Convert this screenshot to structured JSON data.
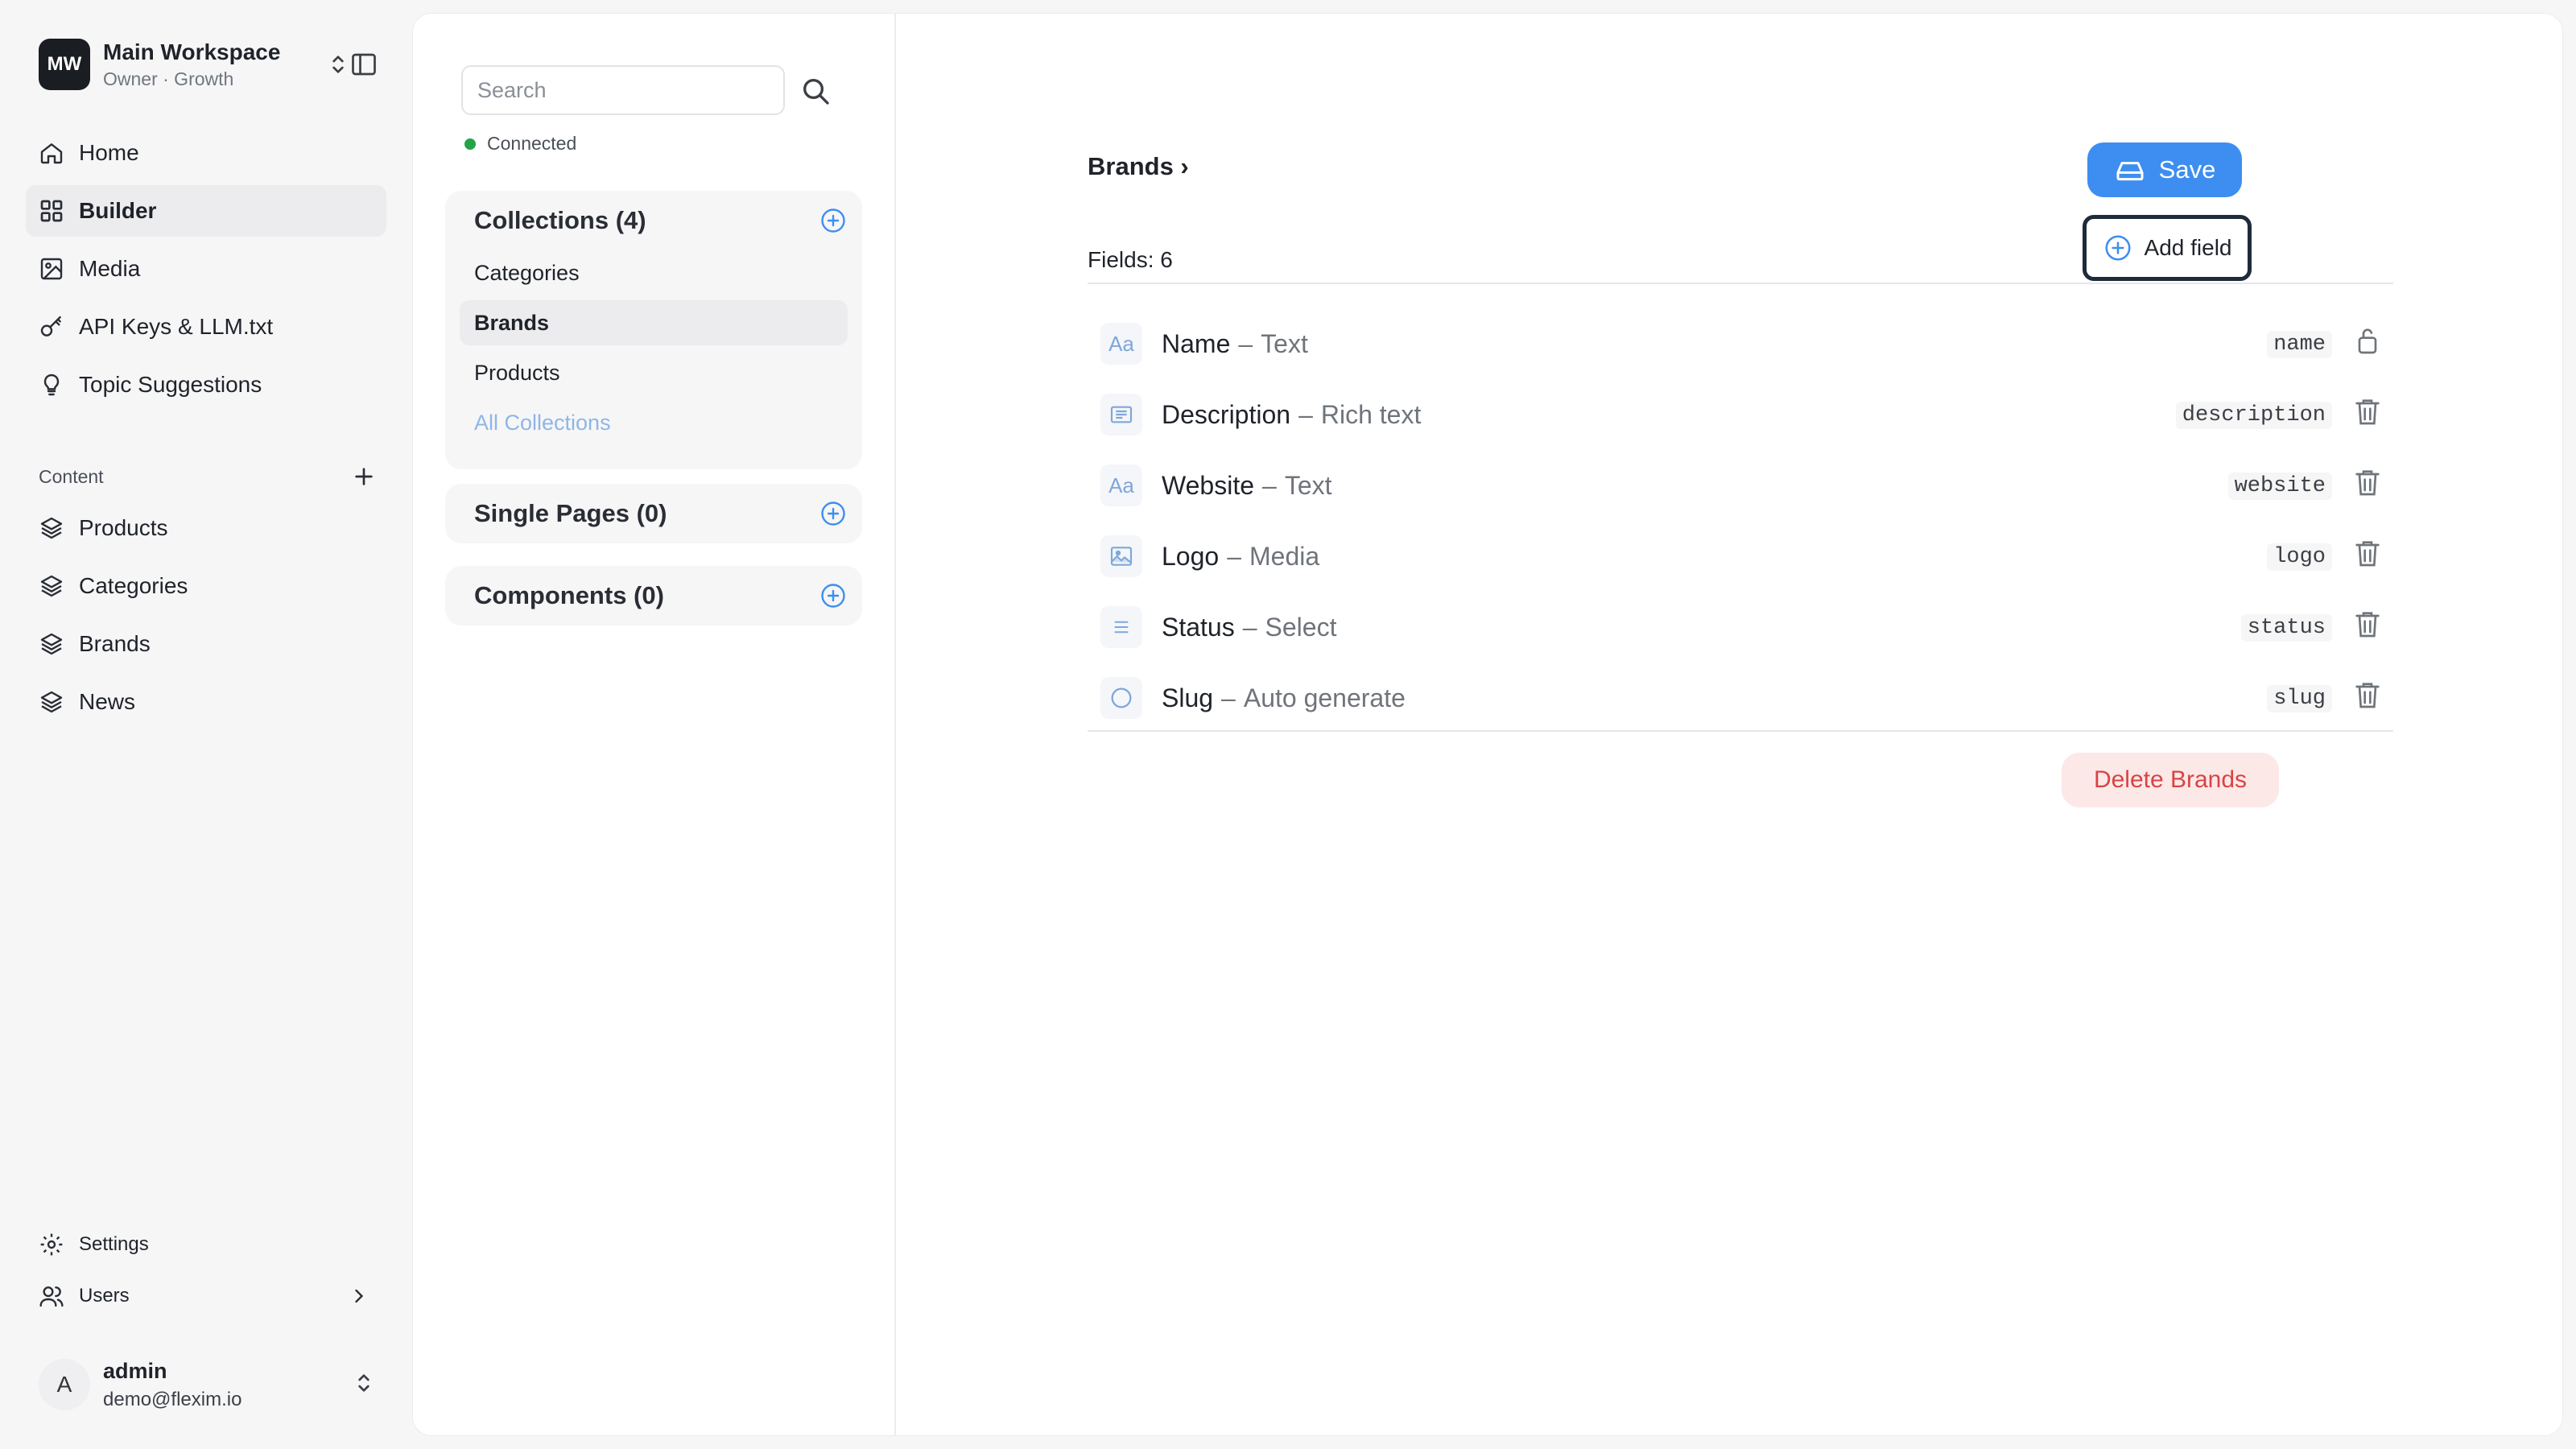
{
  "workspace": {
    "initials": "MW",
    "name": "Main Workspace",
    "subtitle": "Owner · Growth"
  },
  "nav": [
    {
      "label": "Home",
      "icon": "home-icon"
    },
    {
      "label": "Builder",
      "icon": "grid-icon",
      "active": true
    },
    {
      "label": "Media",
      "icon": "image-icon"
    },
    {
      "label": "API Keys & LLM.txt",
      "icon": "key-icon"
    },
    {
      "label": "Topic Suggestions",
      "icon": "lightbulb-icon"
    }
  ],
  "content_section": {
    "title": "Content",
    "items": [
      {
        "label": "Products",
        "icon": "layers-icon"
      },
      {
        "label": "Categories",
        "icon": "layers-icon"
      },
      {
        "label": "Brands",
        "icon": "layers-icon"
      },
      {
        "label": "News",
        "icon": "layers-icon"
      }
    ]
  },
  "bottom_nav": {
    "settings": "Settings",
    "users": "Users"
  },
  "user": {
    "initial": "A",
    "name": "admin",
    "email": "demo@flexim.io"
  },
  "search": {
    "placeholder": "Search",
    "status": "Connected",
    "status_color": "#22a447"
  },
  "collections": {
    "title": "Collections (4)",
    "items": [
      "Categories",
      "Brands",
      "Products"
    ],
    "active": "Brands",
    "all_link": "All Collections"
  },
  "single_pages": {
    "title": "Single Pages (0)"
  },
  "components": {
    "title": "Components (0)"
  },
  "editor": {
    "breadcrumb": "Brands ›",
    "save_label": "Save",
    "fields_count": "Fields: 6",
    "add_field_label": "Add field",
    "delete_label": "Delete Brands",
    "accent_color": "#3d8ef0",
    "fields": [
      {
        "name": "Name",
        "type": "Text",
        "key": "name",
        "icon": "text-aa-icon",
        "action": "lock-icon"
      },
      {
        "name": "Description",
        "type": "Rich text",
        "key": "description",
        "icon": "rich-text-icon",
        "action": "trash-icon"
      },
      {
        "name": "Website",
        "type": "Text",
        "key": "website",
        "icon": "text-aa-icon",
        "action": "trash-icon"
      },
      {
        "name": "Logo",
        "type": "Media",
        "key": "logo",
        "icon": "image-icon",
        "action": "trash-icon"
      },
      {
        "name": "Status",
        "type": "Select",
        "key": "status",
        "icon": "select-list-icon",
        "action": "trash-icon"
      },
      {
        "name": "Slug",
        "type": "Auto generate",
        "key": "slug",
        "icon": "circle-icon",
        "action": "trash-icon"
      }
    ]
  }
}
